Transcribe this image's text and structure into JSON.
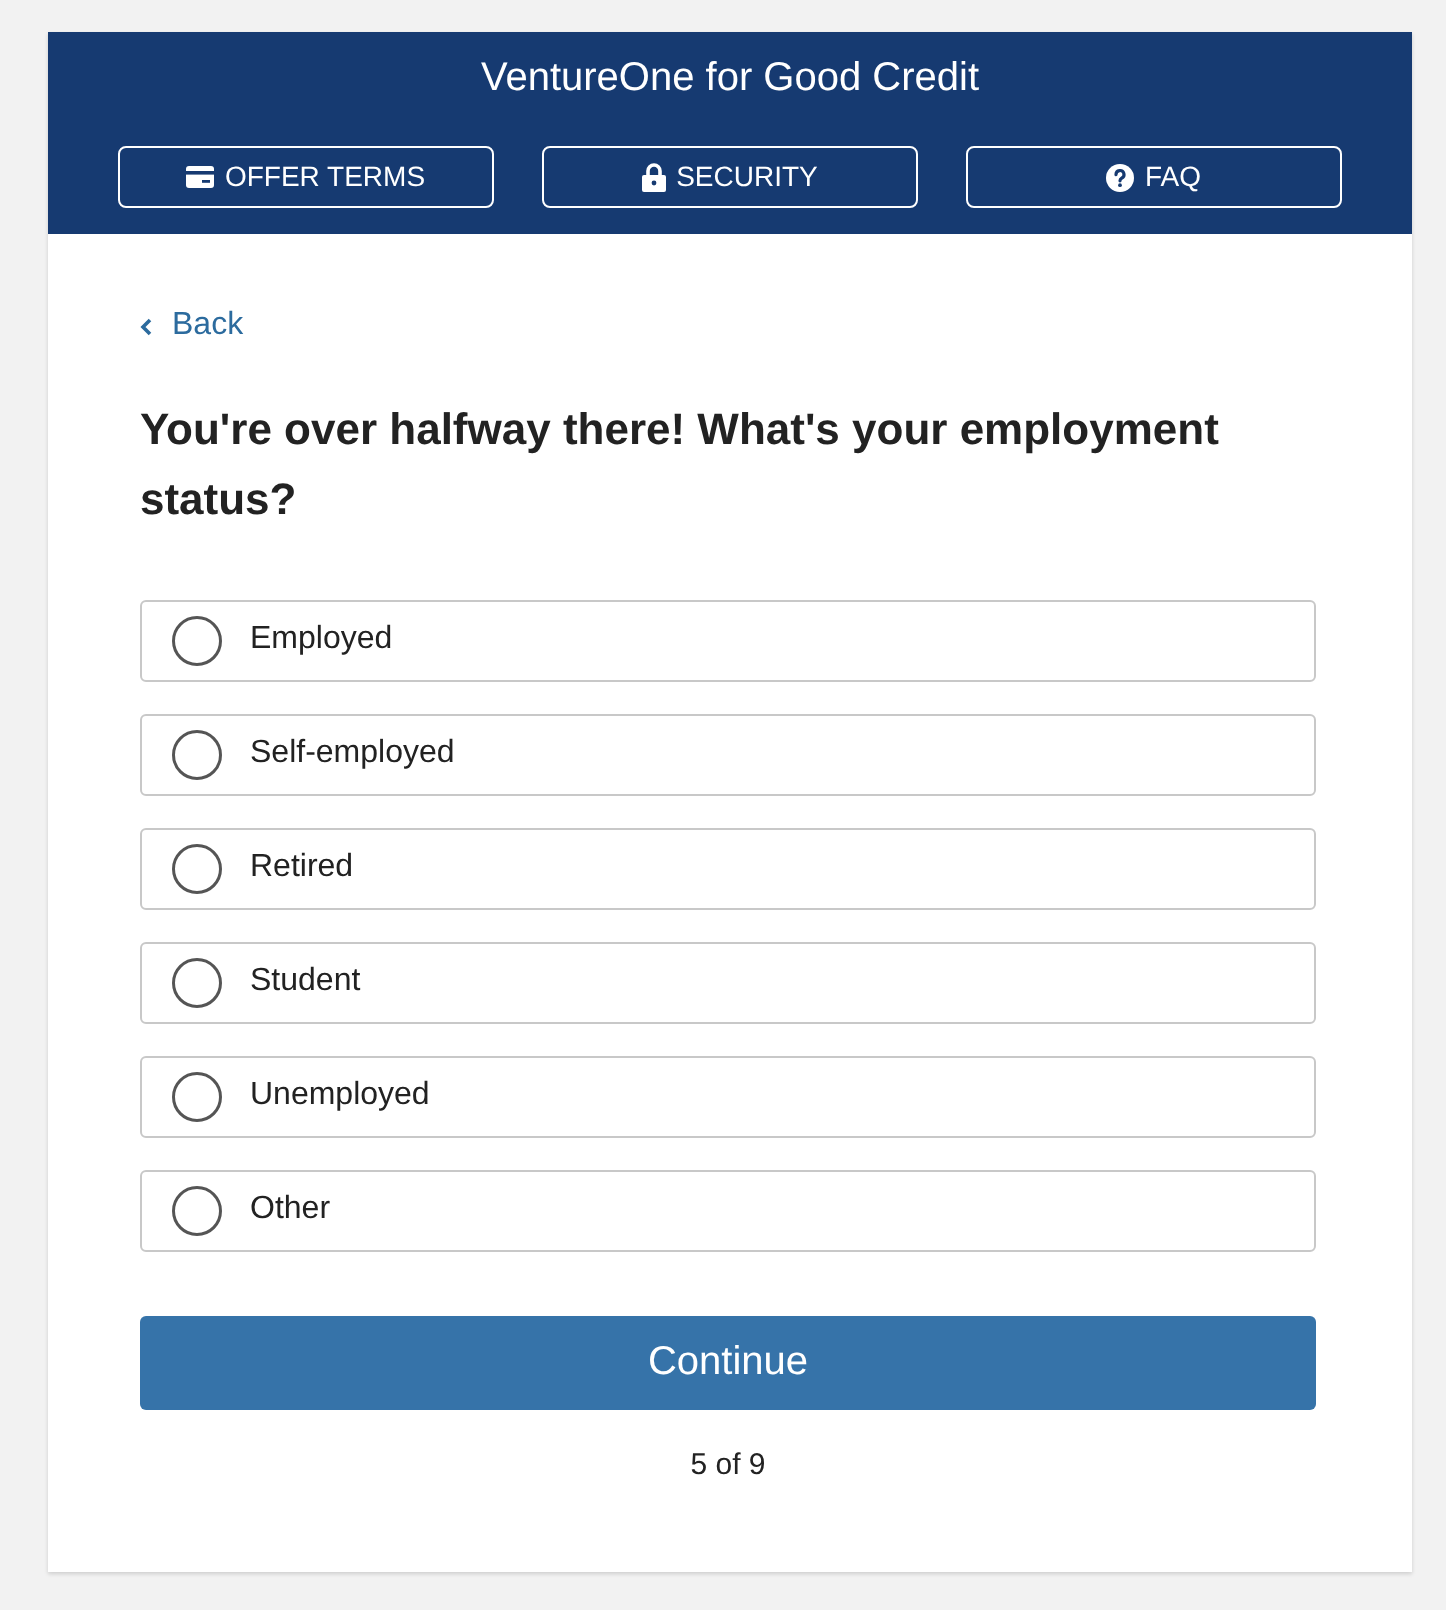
{
  "header": {
    "title": "VentureOne for Good Credit",
    "buttons": [
      {
        "label": "OFFER TERMS",
        "kind": "card"
      },
      {
        "label": "SECURITY",
        "kind": "lock"
      },
      {
        "label": "FAQ",
        "kind": "question"
      }
    ]
  },
  "back_link": {
    "label": "Back"
  },
  "question": "You're over halfway there! What's your employment status?",
  "options": [
    {
      "label": "Employed",
      "selected": false
    },
    {
      "label": "Self-employed",
      "selected": false
    },
    {
      "label": "Retired",
      "selected": false
    },
    {
      "label": "Student",
      "selected": false
    },
    {
      "label": "Unemployed",
      "selected": false
    },
    {
      "label": "Other",
      "selected": false
    }
  ],
  "continue_button": {
    "label": "Continue"
  },
  "progress": "5 of 9"
}
